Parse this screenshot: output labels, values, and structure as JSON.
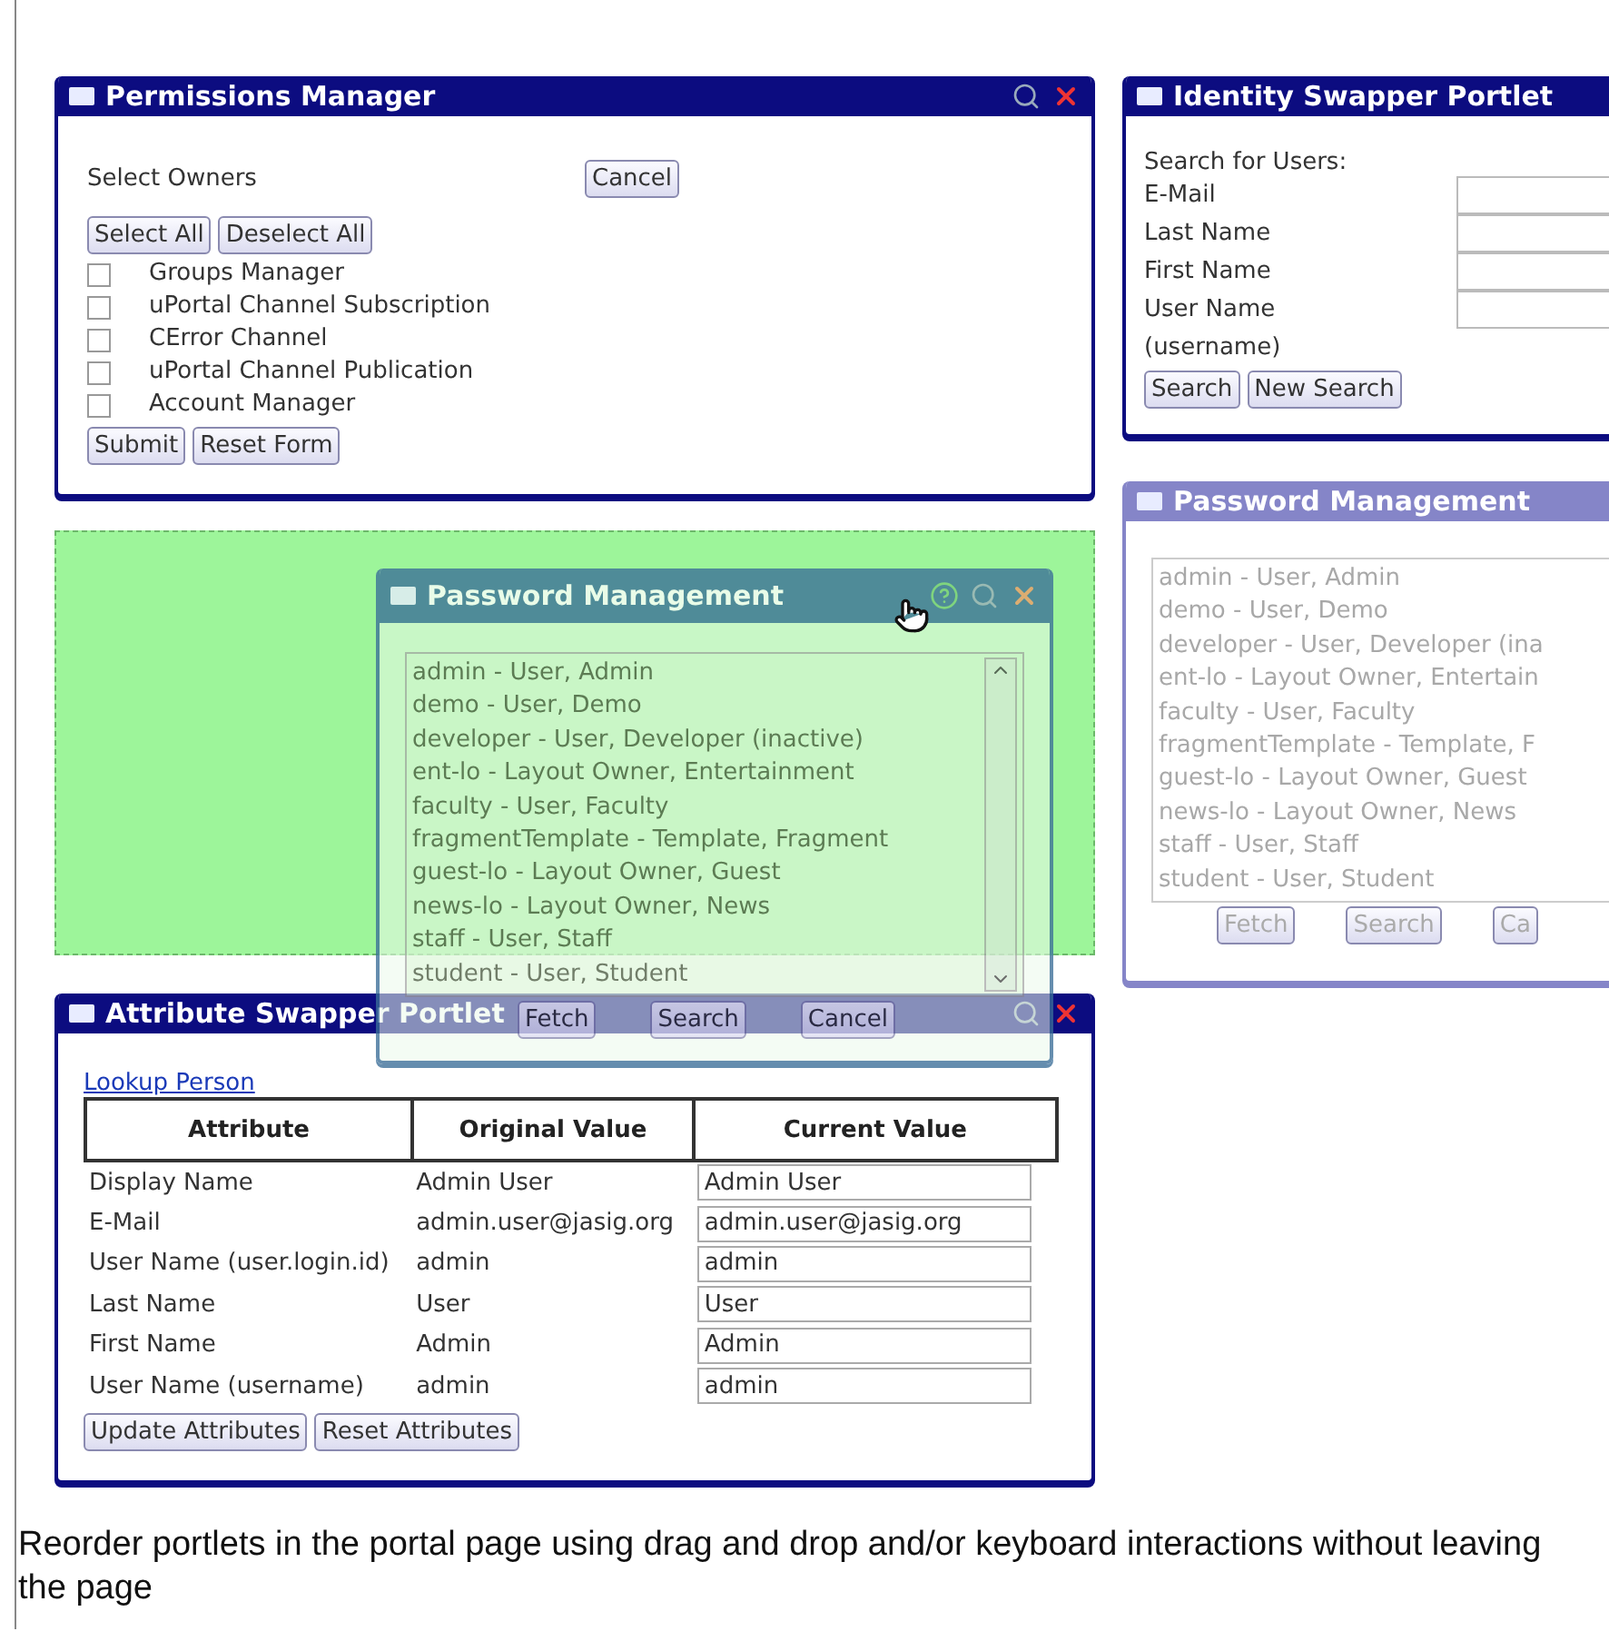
{
  "permissions_manager": {
    "title": "Permissions Manager",
    "heading": "Select Owners",
    "cancel": "Cancel",
    "select_buttons": [
      "Select All",
      "Deselect All"
    ],
    "owners": [
      {
        "label": "Groups Manager",
        "checked": false
      },
      {
        "label": "uPortal Channel Subscription",
        "checked": false
      },
      {
        "label": "CError Channel",
        "checked": false
      },
      {
        "label": "uPortal Channel Publication",
        "checked": false
      },
      {
        "label": "Account Manager",
        "checked": false
      }
    ],
    "buttons": [
      "Submit",
      "Reset Form"
    ]
  },
  "dragged_portlet": {
    "title": "Password Management",
    "users": [
      "admin - User, Admin",
      "demo - User, Demo",
      "developer - User, Developer (inactive)",
      "ent-lo - Layout Owner, Entertainment",
      "faculty - User, Faculty",
      "fragmentTemplate - Template, Fragment",
      "guest-lo - Layout Owner, Guest",
      "news-lo - Layout Owner, News",
      "staff - User, Staff",
      "student - User, Student"
    ],
    "buttons": [
      "Fetch",
      "Search",
      "Cancel"
    ]
  },
  "attribute_swapper": {
    "title": "Attribute Swapper Portlet",
    "link": "Lookup Person",
    "columns": [
      "Attribute",
      "Original Value",
      "Current Value"
    ],
    "rows": [
      {
        "attribute": "Display Name",
        "original": "Admin User",
        "current": "Admin User"
      },
      {
        "attribute": "E-Mail",
        "original": "admin.user@jasig.org",
        "current": "admin.user@jasig.org"
      },
      {
        "attribute": "User Name (user.login.id)",
        "original": "admin",
        "current": "admin"
      },
      {
        "attribute": "Last Name",
        "original": "User",
        "current": "User"
      },
      {
        "attribute": "First Name",
        "original": "Admin",
        "current": "Admin"
      },
      {
        "attribute": "User Name (username)",
        "original": "admin",
        "current": "admin"
      }
    ],
    "buttons": [
      "Update Attributes",
      "Reset Attributes"
    ]
  },
  "identity_swapper": {
    "title": "Identity Swapper Portlet",
    "heading": "Search for Users:",
    "fields": [
      "E-Mail",
      "Last Name",
      "First Name",
      "User Name (username)"
    ],
    "buttons": [
      "Search",
      "New Search"
    ]
  },
  "password_placeholder": {
    "title": "Password Management",
    "users": [
      "admin - User, Admin",
      "demo - User, Demo",
      "developer - User, Developer (ina",
      "ent-lo - Layout Owner, Entertain",
      "faculty - User, Faculty",
      "fragmentTemplate - Template, F",
      "guest-lo - Layout Owner, Guest",
      "news-lo - Layout Owner, News",
      "staff - User, Staff",
      "student - User, Student"
    ],
    "buttons": [
      "Fetch",
      "Search",
      "Ca"
    ]
  },
  "caption": "Reorder portlets in the portal page using drag and drop and/or keyboard interactions without leaving the page"
}
